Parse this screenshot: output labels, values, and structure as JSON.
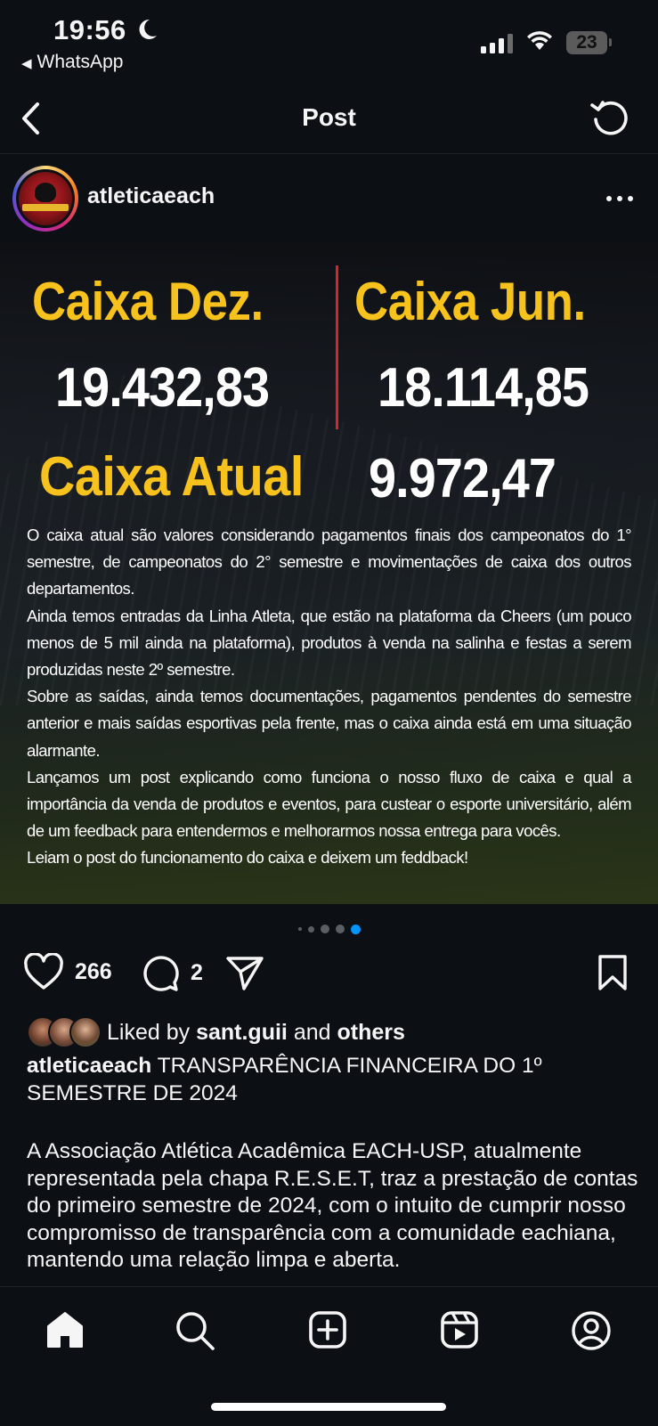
{
  "status_bar": {
    "time": "19:56",
    "back_app": "WhatsApp",
    "battery": "23",
    "icons": [
      "moon-icon",
      "signal-icon",
      "wifi-icon",
      "battery-icon"
    ]
  },
  "header": {
    "title": "Post",
    "icons": [
      "back-arrow-icon",
      "refresh-icon"
    ]
  },
  "post": {
    "username": "atleticaeach",
    "image": {
      "caixa_dez_label": "Caixa Dez.",
      "caixa_dez_value": "19.432,83",
      "caixa_jun_label": "Caixa Jun.",
      "caixa_jun_value": "18.114,85",
      "caixa_atual_label": "Caixa Atual",
      "caixa_atual_value": "9.972,47",
      "paragraphs": [
        "O caixa atual são valores considerando pagamentos finais dos campeonatos do 1° semestre, de campeonatos do 2° semestre e movimentações de caixa dos outros departamentos.",
        "Ainda temos entradas da Linha Atleta, que estão na plataforma da Cheers (um pouco menos de 5 mil ainda na plataforma), produtos à venda na salinha e festas a serem produzidas neste 2º semestre.",
        "Sobre as saídas, ainda temos documentações, pagamentos pendentes do semestre anterior e mais saídas esportivas pela frente, mas o caixa ainda está em uma situação alarmante.",
        "Lançamos um post explicando como funciona o nosso fluxo de caixa e qual a importância da venda de produtos e eventos, para custear o esporte universitário, além de um feedback para entendermos e melhorarmos nossa entrega para vocês.",
        "Leiam o post do funcionamento do caixa e deixem um feddback!"
      ]
    },
    "carousel": {
      "total": 5,
      "active_index": 4
    },
    "likes_count": "266",
    "comments_count": "2",
    "liked_by": {
      "prefix": "Liked by",
      "user": "sant.guii",
      "conjunction": "and",
      "others": "others"
    },
    "caption": {
      "username": "atleticaeach",
      "text": "TRANSPARÊNCIA FINANCEIRA DO 1º SEMESTRE DE 2024",
      "body": "A Associação Atlética Acadêmica EACH-USP, atualmente representada pela chapa R.E.S.E.T, traz a prestação de contas do primeiro semestre de 2024, com o intuito de cumprir nosso compromisso de transparência com a comunidade eachiana, mantendo uma relação limpa e aberta."
    }
  },
  "bottom_nav": [
    "home-icon",
    "search-icon",
    "new-post-icon",
    "reels-icon",
    "profile-icon"
  ],
  "colors": {
    "background": "#0c1014",
    "accent_yellow": "#f7c21b",
    "divider_red": "#d8242a",
    "active_dot": "#0095f6"
  }
}
